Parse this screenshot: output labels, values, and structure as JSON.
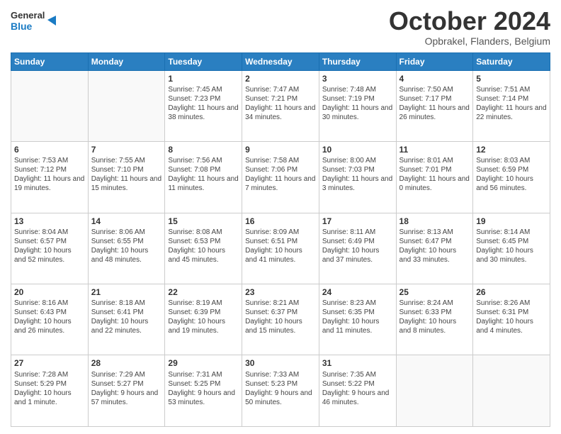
{
  "logo": {
    "general": "General",
    "blue": "Blue"
  },
  "header": {
    "month": "October 2024",
    "location": "Opbrakel, Flanders, Belgium"
  },
  "days_of_week": [
    "Sunday",
    "Monday",
    "Tuesday",
    "Wednesday",
    "Thursday",
    "Friday",
    "Saturday"
  ],
  "weeks": [
    [
      {
        "day": "",
        "info": ""
      },
      {
        "day": "",
        "info": ""
      },
      {
        "day": "1",
        "info": "Sunrise: 7:45 AM\nSunset: 7:23 PM\nDaylight: 11 hours and 38 minutes."
      },
      {
        "day": "2",
        "info": "Sunrise: 7:47 AM\nSunset: 7:21 PM\nDaylight: 11 hours and 34 minutes."
      },
      {
        "day": "3",
        "info": "Sunrise: 7:48 AM\nSunset: 7:19 PM\nDaylight: 11 hours and 30 minutes."
      },
      {
        "day": "4",
        "info": "Sunrise: 7:50 AM\nSunset: 7:17 PM\nDaylight: 11 hours and 26 minutes."
      },
      {
        "day": "5",
        "info": "Sunrise: 7:51 AM\nSunset: 7:14 PM\nDaylight: 11 hours and 22 minutes."
      }
    ],
    [
      {
        "day": "6",
        "info": "Sunrise: 7:53 AM\nSunset: 7:12 PM\nDaylight: 11 hours and 19 minutes."
      },
      {
        "day": "7",
        "info": "Sunrise: 7:55 AM\nSunset: 7:10 PM\nDaylight: 11 hours and 15 minutes."
      },
      {
        "day": "8",
        "info": "Sunrise: 7:56 AM\nSunset: 7:08 PM\nDaylight: 11 hours and 11 minutes."
      },
      {
        "day": "9",
        "info": "Sunrise: 7:58 AM\nSunset: 7:06 PM\nDaylight: 11 hours and 7 minutes."
      },
      {
        "day": "10",
        "info": "Sunrise: 8:00 AM\nSunset: 7:03 PM\nDaylight: 11 hours and 3 minutes."
      },
      {
        "day": "11",
        "info": "Sunrise: 8:01 AM\nSunset: 7:01 PM\nDaylight: 11 hours and 0 minutes."
      },
      {
        "day": "12",
        "info": "Sunrise: 8:03 AM\nSunset: 6:59 PM\nDaylight: 10 hours and 56 minutes."
      }
    ],
    [
      {
        "day": "13",
        "info": "Sunrise: 8:04 AM\nSunset: 6:57 PM\nDaylight: 10 hours and 52 minutes."
      },
      {
        "day": "14",
        "info": "Sunrise: 8:06 AM\nSunset: 6:55 PM\nDaylight: 10 hours and 48 minutes."
      },
      {
        "day": "15",
        "info": "Sunrise: 8:08 AM\nSunset: 6:53 PM\nDaylight: 10 hours and 45 minutes."
      },
      {
        "day": "16",
        "info": "Sunrise: 8:09 AM\nSunset: 6:51 PM\nDaylight: 10 hours and 41 minutes."
      },
      {
        "day": "17",
        "info": "Sunrise: 8:11 AM\nSunset: 6:49 PM\nDaylight: 10 hours and 37 minutes."
      },
      {
        "day": "18",
        "info": "Sunrise: 8:13 AM\nSunset: 6:47 PM\nDaylight: 10 hours and 33 minutes."
      },
      {
        "day": "19",
        "info": "Sunrise: 8:14 AM\nSunset: 6:45 PM\nDaylight: 10 hours and 30 minutes."
      }
    ],
    [
      {
        "day": "20",
        "info": "Sunrise: 8:16 AM\nSunset: 6:43 PM\nDaylight: 10 hours and 26 minutes."
      },
      {
        "day": "21",
        "info": "Sunrise: 8:18 AM\nSunset: 6:41 PM\nDaylight: 10 hours and 22 minutes."
      },
      {
        "day": "22",
        "info": "Sunrise: 8:19 AM\nSunset: 6:39 PM\nDaylight: 10 hours and 19 minutes."
      },
      {
        "day": "23",
        "info": "Sunrise: 8:21 AM\nSunset: 6:37 PM\nDaylight: 10 hours and 15 minutes."
      },
      {
        "day": "24",
        "info": "Sunrise: 8:23 AM\nSunset: 6:35 PM\nDaylight: 10 hours and 11 minutes."
      },
      {
        "day": "25",
        "info": "Sunrise: 8:24 AM\nSunset: 6:33 PM\nDaylight: 10 hours and 8 minutes."
      },
      {
        "day": "26",
        "info": "Sunrise: 8:26 AM\nSunset: 6:31 PM\nDaylight: 10 hours and 4 minutes."
      }
    ],
    [
      {
        "day": "27",
        "info": "Sunrise: 7:28 AM\nSunset: 5:29 PM\nDaylight: 10 hours and 1 minute."
      },
      {
        "day": "28",
        "info": "Sunrise: 7:29 AM\nSunset: 5:27 PM\nDaylight: 9 hours and 57 minutes."
      },
      {
        "day": "29",
        "info": "Sunrise: 7:31 AM\nSunset: 5:25 PM\nDaylight: 9 hours and 53 minutes."
      },
      {
        "day": "30",
        "info": "Sunrise: 7:33 AM\nSunset: 5:23 PM\nDaylight: 9 hours and 50 minutes."
      },
      {
        "day": "31",
        "info": "Sunrise: 7:35 AM\nSunset: 5:22 PM\nDaylight: 9 hours and 46 minutes."
      },
      {
        "day": "",
        "info": ""
      },
      {
        "day": "",
        "info": ""
      }
    ]
  ]
}
